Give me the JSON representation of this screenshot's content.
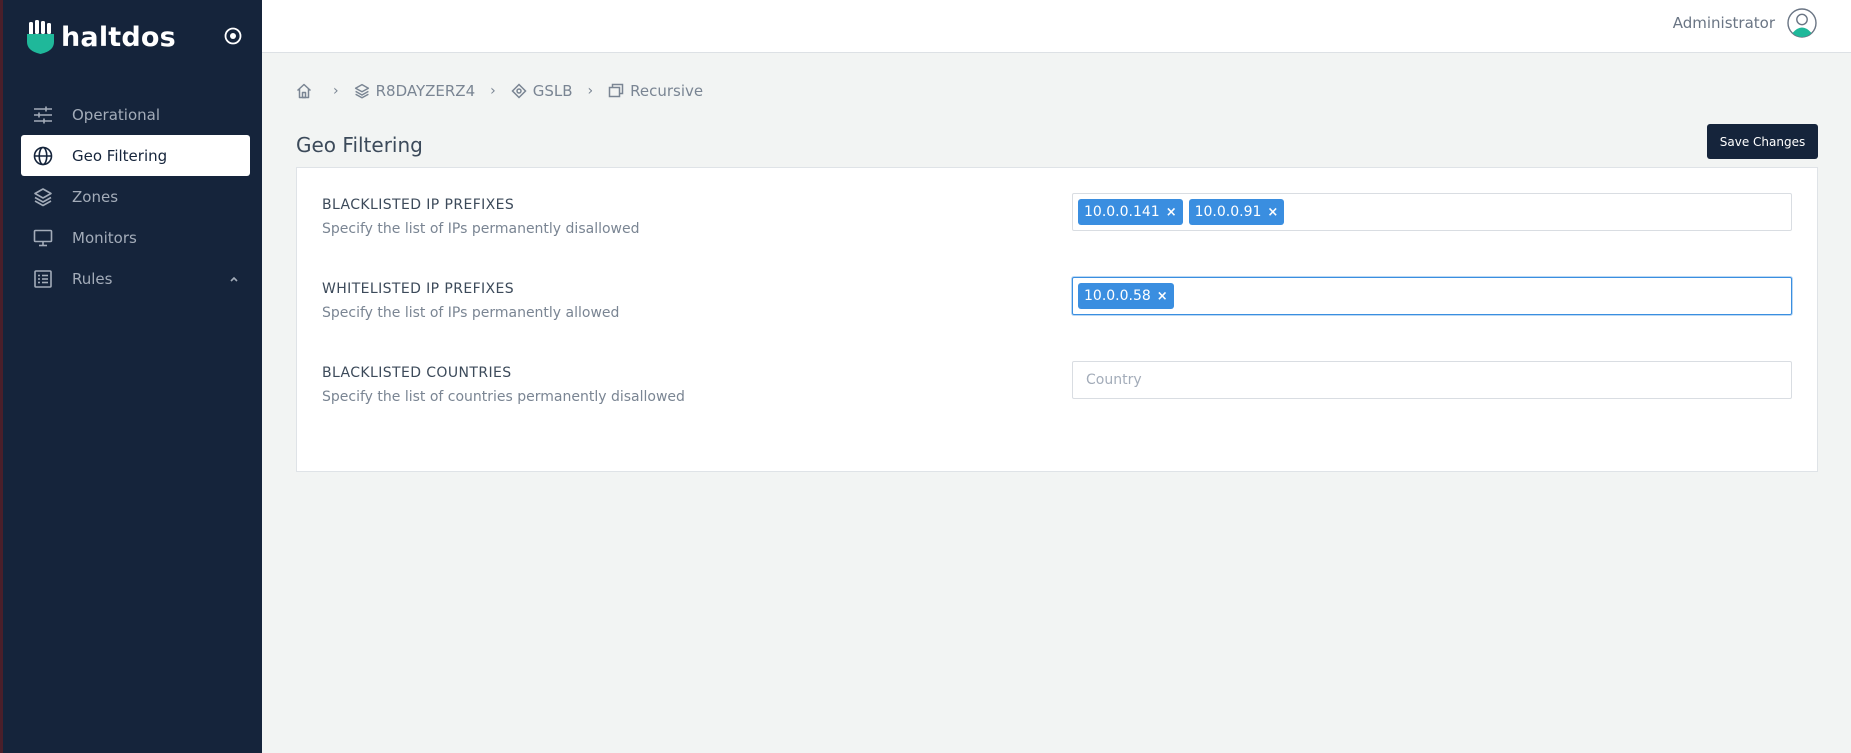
{
  "app": {
    "logo_text": "haltdos"
  },
  "sidebar": {
    "items": [
      {
        "label": "Operational",
        "icon": "sliders-icon"
      },
      {
        "label": "Geo Filtering",
        "icon": "globe-icon"
      },
      {
        "label": "Zones",
        "icon": "layers-icon"
      },
      {
        "label": "Monitors",
        "icon": "monitor-icon"
      },
      {
        "label": "Rules",
        "icon": "list-icon"
      }
    ]
  },
  "header": {
    "user_name": "Administrator"
  },
  "breadcrumb": [
    {
      "label": ""
    },
    {
      "label": "R8DAYZERZ4"
    },
    {
      "label": "GSLB"
    },
    {
      "label": "Recursive"
    }
  ],
  "page": {
    "title": "Geo Filtering",
    "save_label": "Save Changes"
  },
  "form": {
    "blacklisted_ips": {
      "label": "BLACKLISTED IP PREFIXES",
      "description": "Specify the list of IPs permanently disallowed",
      "tags": [
        "10.0.0.141",
        "10.0.0.91"
      ]
    },
    "whitelisted_ips": {
      "label": "WHITELISTED IP PREFIXES",
      "description": "Specify the list of IPs permanently allowed",
      "tags": [
        "10.0.0.58"
      ]
    },
    "blacklisted_countries": {
      "label": "BLACKLISTED COUNTRIES",
      "description": "Specify the list of countries permanently disallowed",
      "placeholder": "Country"
    }
  },
  "colors": {
    "sidebar_bg": "#15243b",
    "accent": "#3a8ee0",
    "logo_green": "#1fb89a"
  }
}
